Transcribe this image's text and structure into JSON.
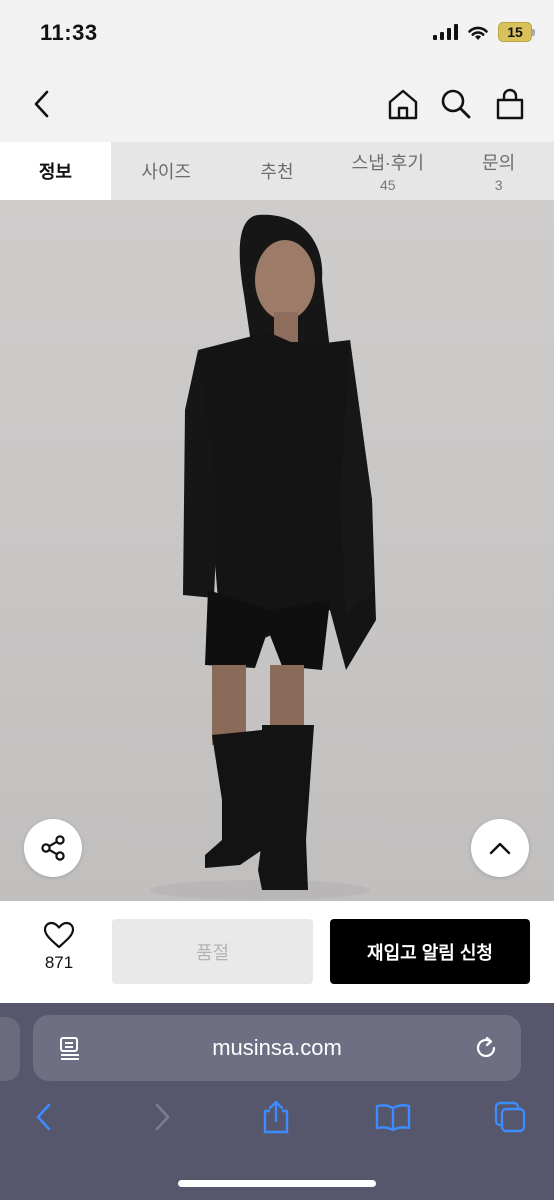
{
  "status_bar": {
    "time": "11:33",
    "battery": "15",
    "battery_color": "#d9c15a"
  },
  "header": {
    "icons": [
      "back-icon",
      "home-icon",
      "search-icon",
      "bag-icon"
    ]
  },
  "tabs": [
    {
      "label": "정보",
      "count": "",
      "active": true
    },
    {
      "label": "사이즈",
      "count": ""
    },
    {
      "label": "추천",
      "count": ""
    },
    {
      "label": "스냅·후기",
      "count": "45"
    },
    {
      "label": "문의",
      "count": "3"
    }
  ],
  "product": {
    "floating": [
      "share-icon",
      "chevron-up-icon"
    ]
  },
  "actions": {
    "like_count": "871",
    "soldout_label": "품절",
    "restock_label": "재입고 알림 신청",
    "restock_color": "#000000"
  },
  "browser": {
    "url": "musinsa.com",
    "background": "#56566c",
    "toolbar_icons": [
      "back-arrow-icon",
      "forward-arrow-icon",
      "share-icon",
      "bookmarks-icon",
      "tabs-icon"
    ],
    "accent": "#3b8cff"
  }
}
